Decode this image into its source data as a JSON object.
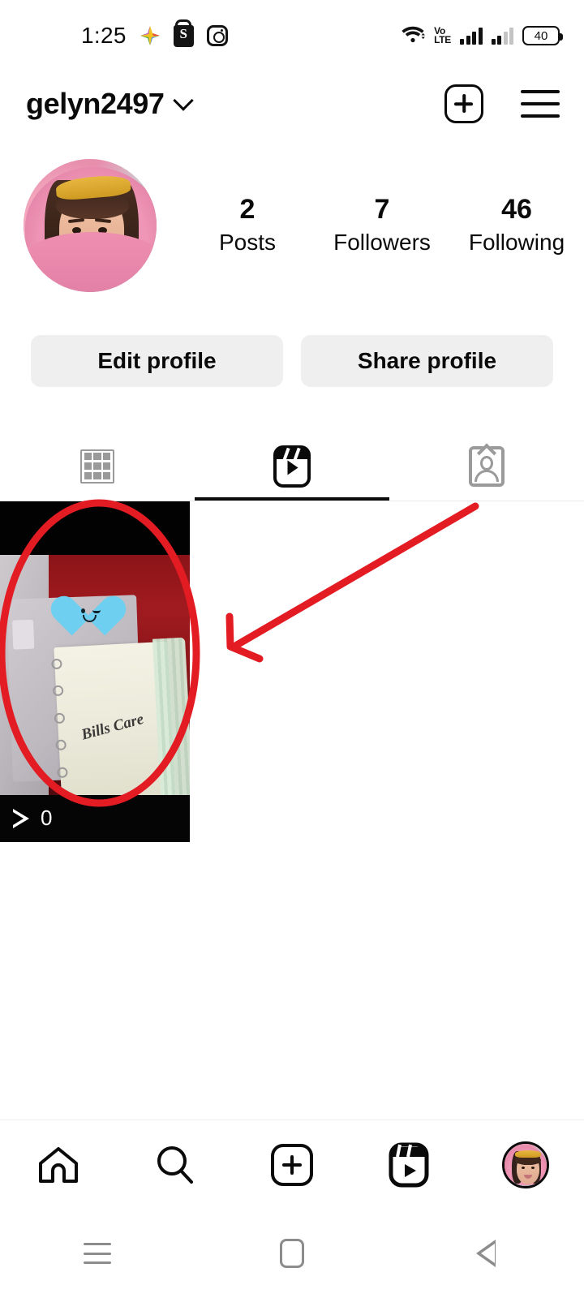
{
  "status_bar": {
    "time": "1:25",
    "left_icons": [
      "sparkle-icon",
      "shopee-icon",
      "instagram-icon"
    ],
    "network_label": "VoLTE",
    "network_label_line1": "Vo",
    "network_label_line2": "LTE",
    "wifi": "wifi-icon",
    "battery_percent": "40"
  },
  "header": {
    "username": "gelyn2497",
    "dropdown_icon": "chevron-down-icon",
    "add_icon": "plus-square-icon",
    "menu_icon": "hamburger-menu-icon"
  },
  "profile": {
    "avatar": "profile-avatar",
    "stats": [
      {
        "value": "2",
        "label": "Posts"
      },
      {
        "value": "7",
        "label": "Followers"
      },
      {
        "value": "46",
        "label": "Following"
      }
    ],
    "buttons": [
      {
        "label": "Edit profile"
      },
      {
        "label": "Share profile"
      }
    ]
  },
  "tabs": [
    {
      "name": "grid",
      "icon": "grid-icon",
      "active": false
    },
    {
      "name": "reels",
      "icon": "reels-icon",
      "active": true
    },
    {
      "name": "tagged",
      "icon": "tagged-person-icon",
      "active": false
    }
  ],
  "reels": [
    {
      "play_count": "0",
      "play_icon": "play-triangle-icon",
      "sticker": "blue-heart-emoji",
      "caption_script": "Bills Care"
    }
  ],
  "annotation": {
    "shape": "red-ellipse",
    "arrow": "red-arrow",
    "color": "#e31b23"
  },
  "bottom_nav": [
    {
      "name": "home",
      "icon": "home-icon",
      "active": false
    },
    {
      "name": "search",
      "icon": "search-icon",
      "active": false
    },
    {
      "name": "create",
      "icon": "plus-square-icon",
      "active": false
    },
    {
      "name": "reels",
      "icon": "reels-icon",
      "active": false
    },
    {
      "name": "profile",
      "icon": "profile-avatar-icon",
      "active": true
    }
  ],
  "android_nav": [
    {
      "name": "recents",
      "icon": "recents-icon"
    },
    {
      "name": "home",
      "icon": "home-square-icon"
    },
    {
      "name": "back",
      "icon": "back-triangle-icon"
    }
  ],
  "colors": {
    "accent": "#e31b23",
    "button_bg": "#efefef",
    "text": "#0a0a0a",
    "inactive_icon": "#9a9a9a",
    "heart": "#6ecff0"
  }
}
